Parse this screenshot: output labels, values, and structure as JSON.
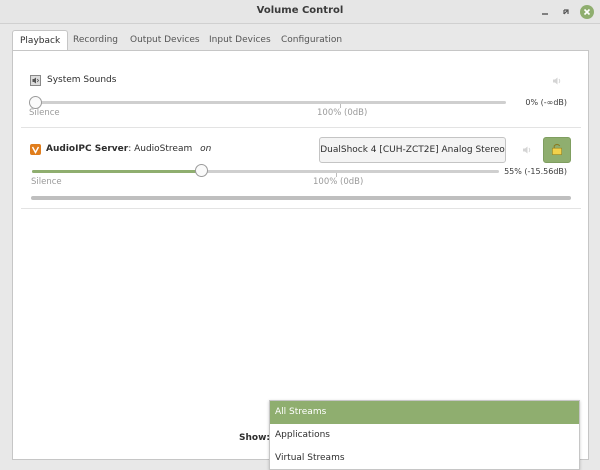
{
  "window": {
    "title": "Volume Control"
  },
  "tabs": [
    {
      "label": "Playback",
      "active": true
    },
    {
      "label": "Recording"
    },
    {
      "label": "Output Devices"
    },
    {
      "label": "Input Devices"
    },
    {
      "label": "Configuration"
    }
  ],
  "streams": [
    {
      "icon": "speaker-icon",
      "name": "System Sounds",
      "app_bold": "",
      "stream_name": "",
      "status": "",
      "silence_label": "Silence",
      "ref_label": "100% (0dB)",
      "level_text": "0% (-∞dB)",
      "volume_percent": 0
    },
    {
      "icon": "audioipc-icon",
      "app_bold": "AudioIPC Server",
      "stream_name": ": AudioStream",
      "status": "on",
      "device": "DualShock 4 [CUH-ZCT2E] Analog Stereo",
      "silence_label": "Silence",
      "ref_label": "100% (0dB)",
      "level_text": "55% (-15.56dB)",
      "volume_percent": 55
    }
  ],
  "footer": {
    "show_label": "Show:",
    "options": [
      "All Streams",
      "Applications",
      "Virtual Streams"
    ],
    "selected": "All Streams"
  },
  "colors": {
    "accent": "#8fae6f"
  }
}
